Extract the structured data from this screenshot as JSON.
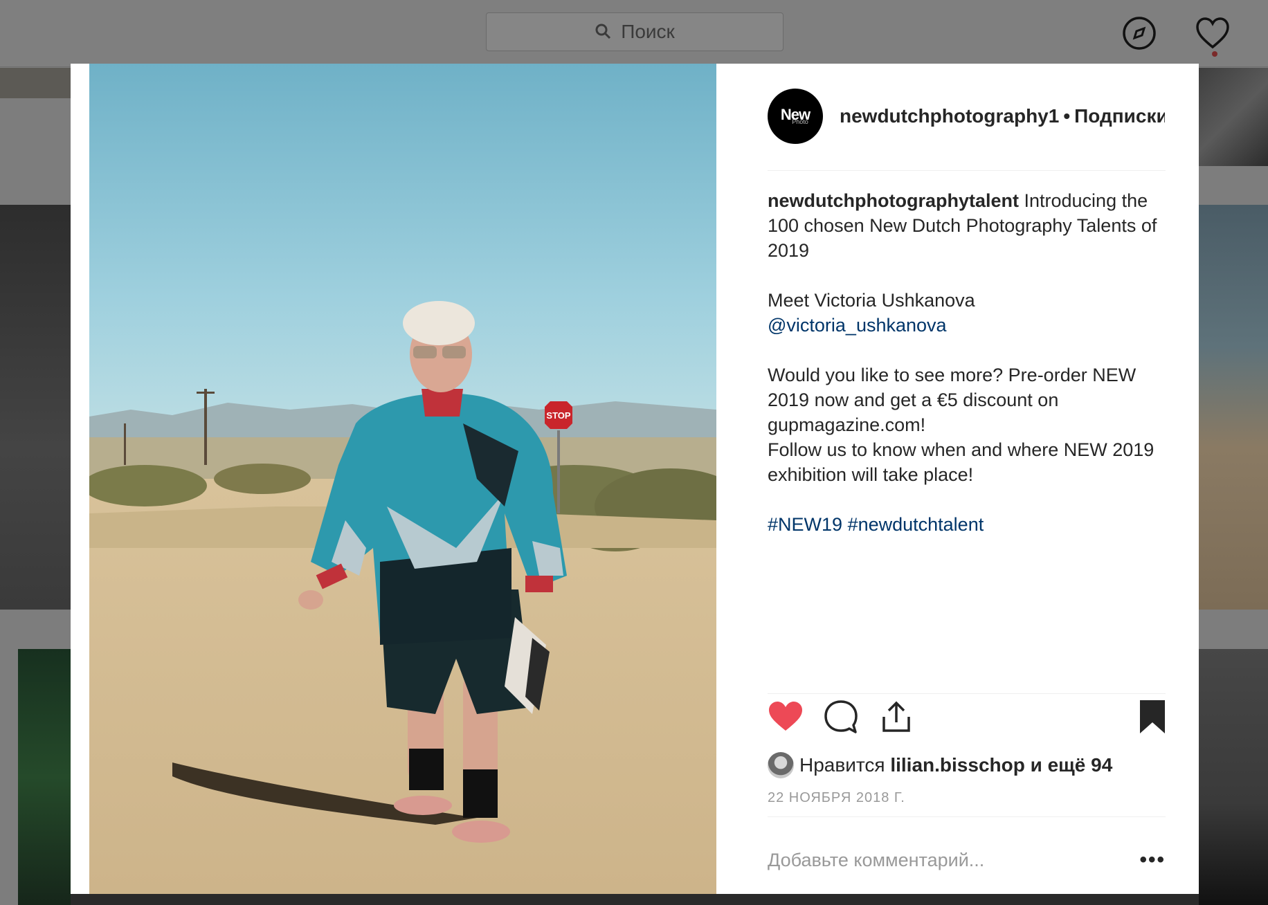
{
  "search": {
    "placeholder": "Поиск"
  },
  "nav": {
    "explore_icon": "compass-icon",
    "activity_icon": "heart-outline-icon"
  },
  "post": {
    "avatar": {
      "line1": "New",
      "line2": "Photo"
    },
    "username_header": "newdutchphotography1",
    "separator": "•",
    "follow_label": "Подписки",
    "caption": {
      "username": "newdutchphotographytalent",
      "intro": "Introducing the 100 chosen New Dutch Photography Talents of 2019",
      "meet": "Meet Victoria Ushkanova",
      "mention": "@victoria_ushkanova",
      "preorder": "Would you like to see more? Pre-order NEW 2019 now and get a €5 discount on gupmagazine.com!",
      "follow": "Follow us to know when and where NEW 2019 exhibition will take place!",
      "tag1": "#NEW19",
      "tag2": "#newdutchtalent"
    },
    "likes": {
      "prefix": "Нравится",
      "user": "lilian.bisschop",
      "suffix": "и ещё 94"
    },
    "date": "22 НОЯБРЯ 2018 Г.",
    "comment_placeholder": "Добавьте комментарий...",
    "more": "•••"
  },
  "colors": {
    "like_red": "#ed4956",
    "link_blue": "#003569",
    "text": "#262626",
    "muted": "#999999"
  }
}
